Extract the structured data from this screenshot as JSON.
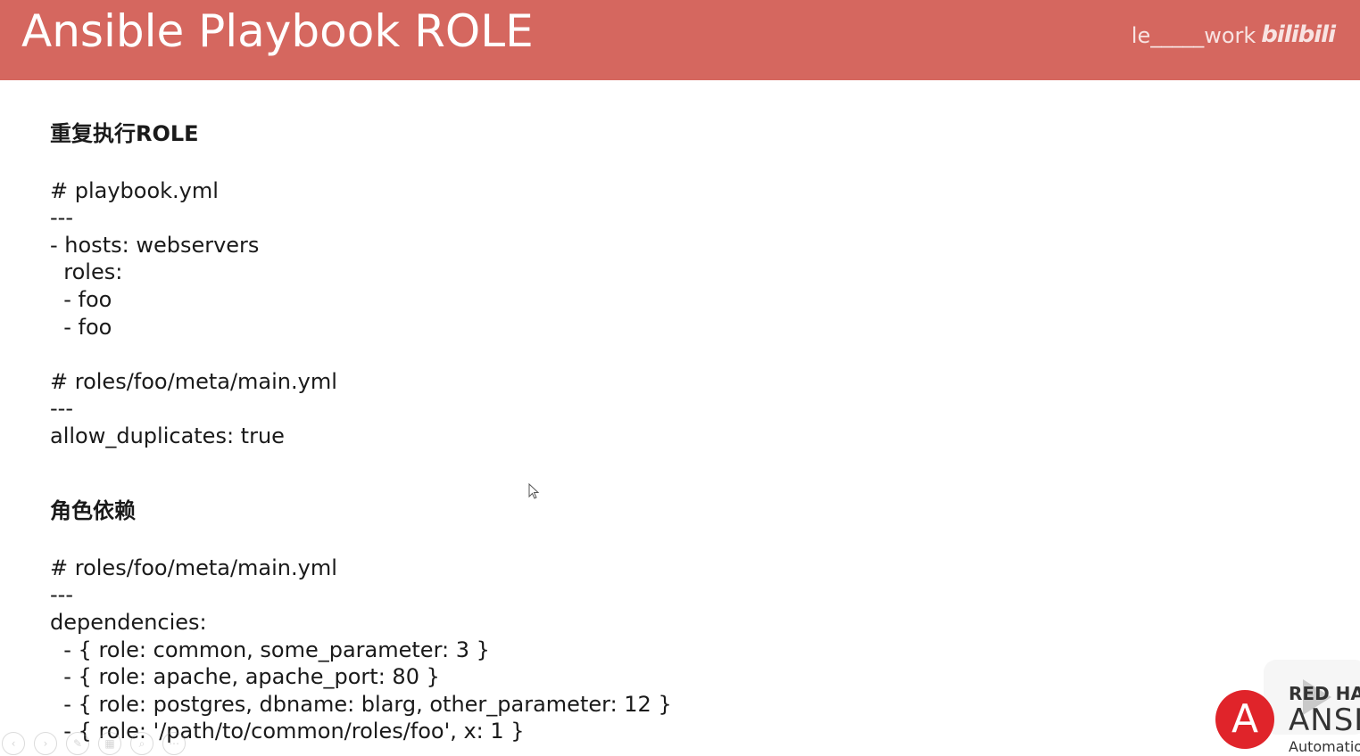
{
  "header": {
    "title": "Ansible Playbook ROLE",
    "watermark_text": "le_____work",
    "watermark_logo": "bilibili",
    "background_color": "#d5675f"
  },
  "sections": [
    {
      "heading": "重复执行ROLE",
      "blocks": [
        [
          "# playbook.yml",
          "---",
          "- hosts: webservers",
          "  roles:",
          "  - foo",
          "  - foo"
        ],
        [
          "# roles/foo/meta/main.yml",
          "---",
          "allow_duplicates: true"
        ]
      ]
    },
    {
      "heading": "角色依赖",
      "blocks": [
        [
          "# roles/foo/meta/main.yml",
          "---",
          "dependencies:",
          "  - { role: common, some_parameter: 3 }",
          "  - { role: apache, apache_port: 80 }",
          "  - { role: postgres, dbname: blarg, other_parameter: 12 }",
          "  - { role: '/path/to/common/roles/foo', x: 1 }"
        ]
      ]
    }
  ],
  "logo": {
    "circle_letter": "A",
    "redhat": "RED HAT",
    "ansible": "ANSIBLE",
    "automation": "Automation",
    "accent_color": "#e0242a"
  },
  "slide_controls": [
    "prev-icon",
    "play-icon",
    "pen-icon",
    "slides-icon",
    "zoom-icon",
    "more-icon"
  ]
}
